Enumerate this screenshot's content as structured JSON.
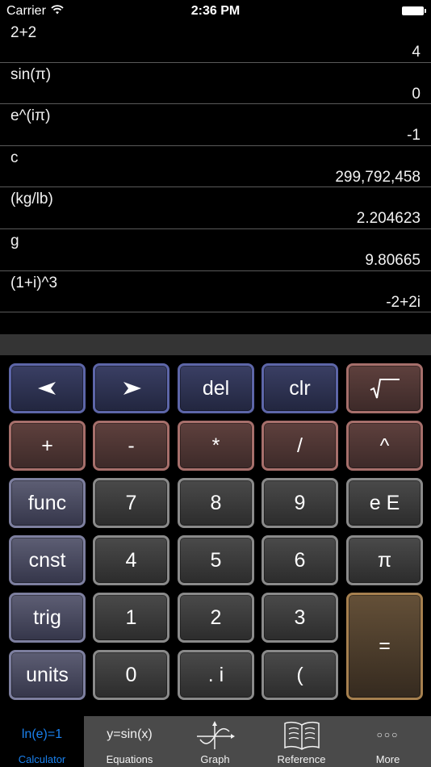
{
  "status_bar": {
    "carrier": "Carrier",
    "time": "2:36 PM"
  },
  "history": [
    {
      "expression": "2+2",
      "result": "4"
    },
    {
      "expression": "sin(π)",
      "result": "0"
    },
    {
      "expression": "e^(iπ)",
      "result": "-1"
    },
    {
      "expression": "c",
      "result": "299,792,458"
    },
    {
      "expression": "(kg/lb)",
      "result": "2.204623"
    },
    {
      "expression": "g",
      "result": "9.80665"
    },
    {
      "expression": "(1+i)^3",
      "result": "-2+2i"
    }
  ],
  "input": {
    "value": ""
  },
  "keypad": {
    "left_arrow": "➤",
    "right_arrow": "➤",
    "del": "del",
    "clr": "clr",
    "sqrt": "√‾‾",
    "plus": "+",
    "minus": "-",
    "multiply": "*",
    "divide": "/",
    "power": "^",
    "func": "func",
    "seven": "7",
    "eight": "8",
    "nine": "9",
    "exp": "e E",
    "cnst": "cnst",
    "four": "4",
    "five": "5",
    "six": "6",
    "pi": "π",
    "trig": "trig",
    "one": "1",
    "two": "2",
    "three": "3",
    "equals": "=",
    "units": "units",
    "zero": "0",
    "dot_i": ". i",
    "paren": "("
  },
  "tabbar": {
    "tabs": [
      {
        "icon_text": "ln(e)=1",
        "label": "Calculator",
        "active": true
      },
      {
        "icon_text": "y=sin(x)",
        "label": "Equations",
        "active": false
      },
      {
        "icon": "graph-icon",
        "label": "Graph",
        "active": false
      },
      {
        "icon": "book-icon",
        "label": "Reference",
        "active": false
      },
      {
        "icon_text": "○○○",
        "label": "More",
        "active": false
      }
    ]
  },
  "colors": {
    "active_tab": "#1a82f0",
    "nav_key_border": "#5d66a8",
    "op_key_border": "#a66f6b",
    "fn_key_border": "#7d7f9f",
    "num_key_border": "#8a8a8a",
    "eq_key_border": "#a6804f"
  }
}
